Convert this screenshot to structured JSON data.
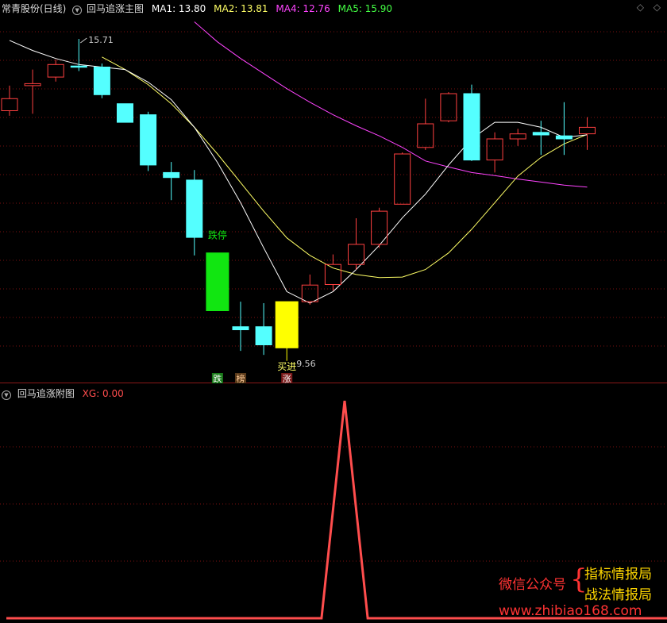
{
  "colors": {
    "background": "#000000",
    "grid": "#7a1010",
    "up": "#ff4040",
    "down": "#54ffff",
    "signal_fall": "#11e611",
    "signal_rise": "#ffff00",
    "ma1": "#ffffff",
    "ma2": "#ffff66",
    "ma4": "#ff44ff",
    "ma5": "#44ff44",
    "xg_line": "#ff4d4d",
    "watermark_red": "#ff3333",
    "watermark_yellow": "#ffd700"
  },
  "main_panel": {
    "stock_name": "常青股份(日线)",
    "indicator_name": "回马追涨主图",
    "ma_legend": [
      {
        "label": "MA1: 13.80",
        "color": "#ffffff"
      },
      {
        "label": "MA2: 13.81",
        "color": "#ffff66"
      },
      {
        "label": "MA4: 12.76",
        "color": "#ff44ff"
      },
      {
        "label": "MA5: 15.90",
        "color": "#44ff44"
      }
    ],
    "high_label": "15.71",
    "low_label": "9.56",
    "fall_label": "跌停",
    "rise_label": "买进",
    "bottom_markers": [
      {
        "text": "跌",
        "bg": "#1a7a1a",
        "color": "#ffffff",
        "index": 9
      },
      {
        "text": "榜",
        "bg": "#5a3a1a",
        "color": "#ffcc99",
        "index": 10
      },
      {
        "text": "涨",
        "bg": "#7a1a1a",
        "color": "#ffffff",
        "index": 12
      }
    ],
    "window_buttons": [
      "diamond-icon",
      "diamond-icon"
    ]
  },
  "sub_panel": {
    "title": "回马追涨附图",
    "xg_label": "XG: 0.00"
  },
  "watermark": {
    "wechat": "微信公众号",
    "brace": "{",
    "line1": "指标情报局",
    "line2": "战法情报局",
    "url": "www.zhibiao168.com"
  },
  "chart_data": {
    "type": "candlestick",
    "y_range": [
      9.2,
      16.2
    ],
    "candles": [
      {
        "o": 14.28,
        "c": 14.52,
        "h": 14.78,
        "l": 14.18,
        "up": true
      },
      {
        "o": 14.78,
        "c": 14.82,
        "h": 15.1,
        "l": 14.22,
        "up": true
      },
      {
        "o": 14.95,
        "c": 15.2,
        "h": 15.3,
        "l": 14.86,
        "up": true
      },
      {
        "o": 15.15,
        "c": 15.17,
        "h": 15.71,
        "l": 15.07,
        "up": false
      },
      {
        "o": 15.15,
        "c": 14.6,
        "h": 15.22,
        "l": 14.53,
        "up": false
      },
      {
        "o": 14.42,
        "c": 14.05,
        "h": 14.42,
        "l": 14.05,
        "up": false
      },
      {
        "o": 14.2,
        "c": 13.2,
        "h": 14.26,
        "l": 13.08,
        "up": false
      },
      {
        "o": 13.05,
        "c": 12.95,
        "h": 13.26,
        "l": 12.5,
        "up": false
      },
      {
        "o": 12.9,
        "c": 11.76,
        "h": 13.1,
        "l": 11.4,
        "up": false
      },
      {
        "o": 11.45,
        "c": 10.3,
        "h": 11.45,
        "l": 10.3,
        "up": false,
        "signal": "fall"
      },
      {
        "o": 9.98,
        "c": 9.92,
        "h": 10.48,
        "l": 9.5,
        "up": false
      },
      {
        "o": 9.98,
        "c": 9.62,
        "h": 10.45,
        "l": 9.42,
        "up": false
      },
      {
        "o": 9.56,
        "c": 10.48,
        "h": 10.48,
        "l": 9.3,
        "up": true,
        "signal": "rise"
      },
      {
        "o": 10.48,
        "c": 10.81,
        "h": 11.02,
        "l": 10.42,
        "up": true
      },
      {
        "o": 10.82,
        "c": 11.22,
        "h": 11.42,
        "l": 10.7,
        "up": true
      },
      {
        "o": 11.22,
        "c": 11.62,
        "h": 12.14,
        "l": 11.12,
        "up": true
      },
      {
        "o": 11.62,
        "c": 12.28,
        "h": 12.35,
        "l": 11.55,
        "up": true
      },
      {
        "o": 12.42,
        "c": 13.42,
        "h": 13.45,
        "l": 12.42,
        "up": true
      },
      {
        "o": 13.55,
        "c": 14.02,
        "h": 14.52,
        "l": 13.5,
        "up": true
      },
      {
        "o": 14.08,
        "c": 14.62,
        "h": 14.65,
        "l": 14.05,
        "up": true
      },
      {
        "o": 14.62,
        "c": 13.3,
        "h": 14.8,
        "l": 13.28,
        "up": false
      },
      {
        "o": 13.3,
        "c": 13.72,
        "h": 13.85,
        "l": 13.05,
        "up": true
      },
      {
        "o": 13.72,
        "c": 13.82,
        "h": 13.92,
        "l": 13.58,
        "up": true
      },
      {
        "o": 13.85,
        "c": 13.8,
        "h": 14.08,
        "l": 13.4,
        "up": false
      },
      {
        "o": 13.78,
        "c": 13.72,
        "h": 14.45,
        "l": 13.4,
        "up": false
      },
      {
        "o": 13.82,
        "c": 13.95,
        "h": 14.15,
        "l": 13.5,
        "up": true
      }
    ],
    "ma1": [
      15.68,
      15.48,
      15.32,
      15.2,
      15.15,
      15.1,
      14.85,
      14.5,
      13.95,
      13.25,
      12.45,
      11.55,
      10.68,
      10.45,
      10.68,
      11.12,
      11.6,
      12.15,
      12.62,
      13.2,
      13.72,
      14.05,
      14.05,
      13.95,
      13.75,
      13.8
    ],
    "ma2": [
      null,
      null,
      null,
      null,
      15.35,
      15.1,
      14.8,
      14.42,
      13.95,
      13.42,
      12.85,
      12.28,
      11.75,
      11.4,
      11.15,
      11.02,
      10.96,
      10.97,
      11.12,
      11.45,
      11.92,
      12.45,
      12.98,
      13.35,
      13.62,
      13.81
    ],
    "ma4": [
      null,
      null,
      null,
      null,
      null,
      null,
      null,
      null,
      16.05,
      15.65,
      15.32,
      15.02,
      14.72,
      14.45,
      14.2,
      13.98,
      13.78,
      13.55,
      13.28,
      13.16,
      13.05,
      12.99,
      12.92,
      12.86,
      12.8,
      12.76
    ],
    "sub": {
      "y_range": [
        0,
        1
      ],
      "values": [
        0,
        0,
        0,
        0,
        0,
        0,
        0,
        0,
        0,
        0,
        0,
        0,
        0,
        0,
        1,
        0,
        0,
        0,
        0,
        0,
        0,
        0,
        0,
        0,
        0,
        0
      ]
    }
  }
}
